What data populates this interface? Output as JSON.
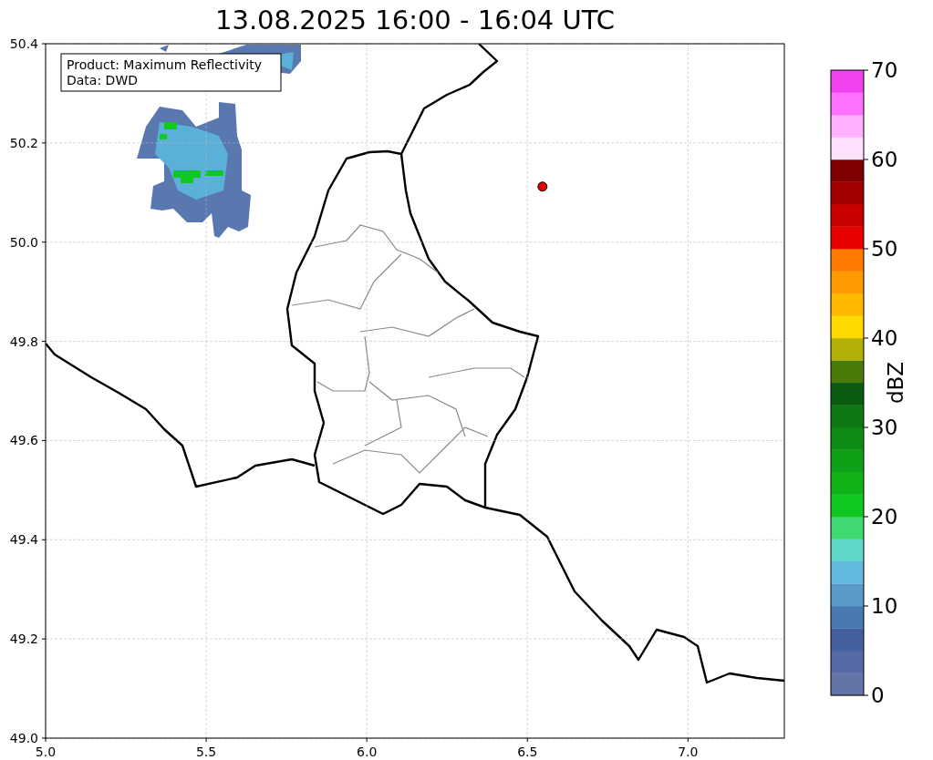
{
  "chart_data": {
    "type": "scatter",
    "title": "13.08.2025 16:00 - 16:04 UTC",
    "xlim": [
      5,
      7.3
    ],
    "ylim": [
      49,
      50.4
    ],
    "xticks": [
      {
        "value": 5,
        "label": "5.0"
      },
      {
        "value": 5.5,
        "label": "5.5"
      },
      {
        "value": 6,
        "label": "6.0"
      },
      {
        "value": 6.5,
        "label": "6.5"
      },
      {
        "value": 7,
        "label": "7.0"
      }
    ],
    "yticks": [
      {
        "value": 49,
        "label": "49.0"
      },
      {
        "value": 49.2,
        "label": "49.2"
      },
      {
        "value": 49.4,
        "label": "49.4"
      },
      {
        "value": 49.6,
        "label": "49.6"
      },
      {
        "value": 49.8,
        "label": "49.8"
      },
      {
        "value": 50,
        "label": "50.0"
      },
      {
        "value": 50.2,
        "label": "50.2"
      },
      {
        "value": 50.4,
        "label": "50.4"
      }
    ],
    "grid": true,
    "x": [
      6.547
    ],
    "series": [
      {
        "color": "#e00000",
        "values": [
          50.112
        ]
      }
    ]
  },
  "info_box": {
    "lines": [
      "Product: Maximum Reflectivity",
      "Data: DWD"
    ]
  },
  "colorbar": {
    "label": "dBZ",
    "ticks": [
      "70",
      "60",
      "50",
      "40",
      "30",
      "20",
      "10",
      "0"
    ],
    "bins": [
      {
        "color": "#6474a6"
      },
      {
        "color": "#566aa6"
      },
      {
        "color": "#4560a0"
      },
      {
        "color": "#4a78b0"
      },
      {
        "color": "#5a9ac8"
      },
      {
        "color": "#62bade"
      },
      {
        "color": "#60d8c8"
      },
      {
        "color": "#40d870"
      },
      {
        "color": "#10c820"
      },
      {
        "color": "#10b418"
      },
      {
        "color": "#10a018"
      },
      {
        "color": "#0e8c14"
      },
      {
        "color": "#0e7814"
      },
      {
        "color": "#0a5c10"
      },
      {
        "color": "#4a7a0a"
      },
      {
        "color": "#b0b008"
      },
      {
        "color": "#ffd800"
      },
      {
        "color": "#ffb800"
      },
      {
        "color": "#ff9a00"
      },
      {
        "color": "#ff7a00"
      },
      {
        "color": "#e80000"
      },
      {
        "color": "#c80000"
      },
      {
        "color": "#a00000"
      },
      {
        "color": "#800000"
      },
      {
        "color": "#ffe0ff"
      },
      {
        "color": "#ffb0ff"
      },
      {
        "color": "#ff70ff"
      },
      {
        "color": "#f040f0"
      }
    ]
  }
}
